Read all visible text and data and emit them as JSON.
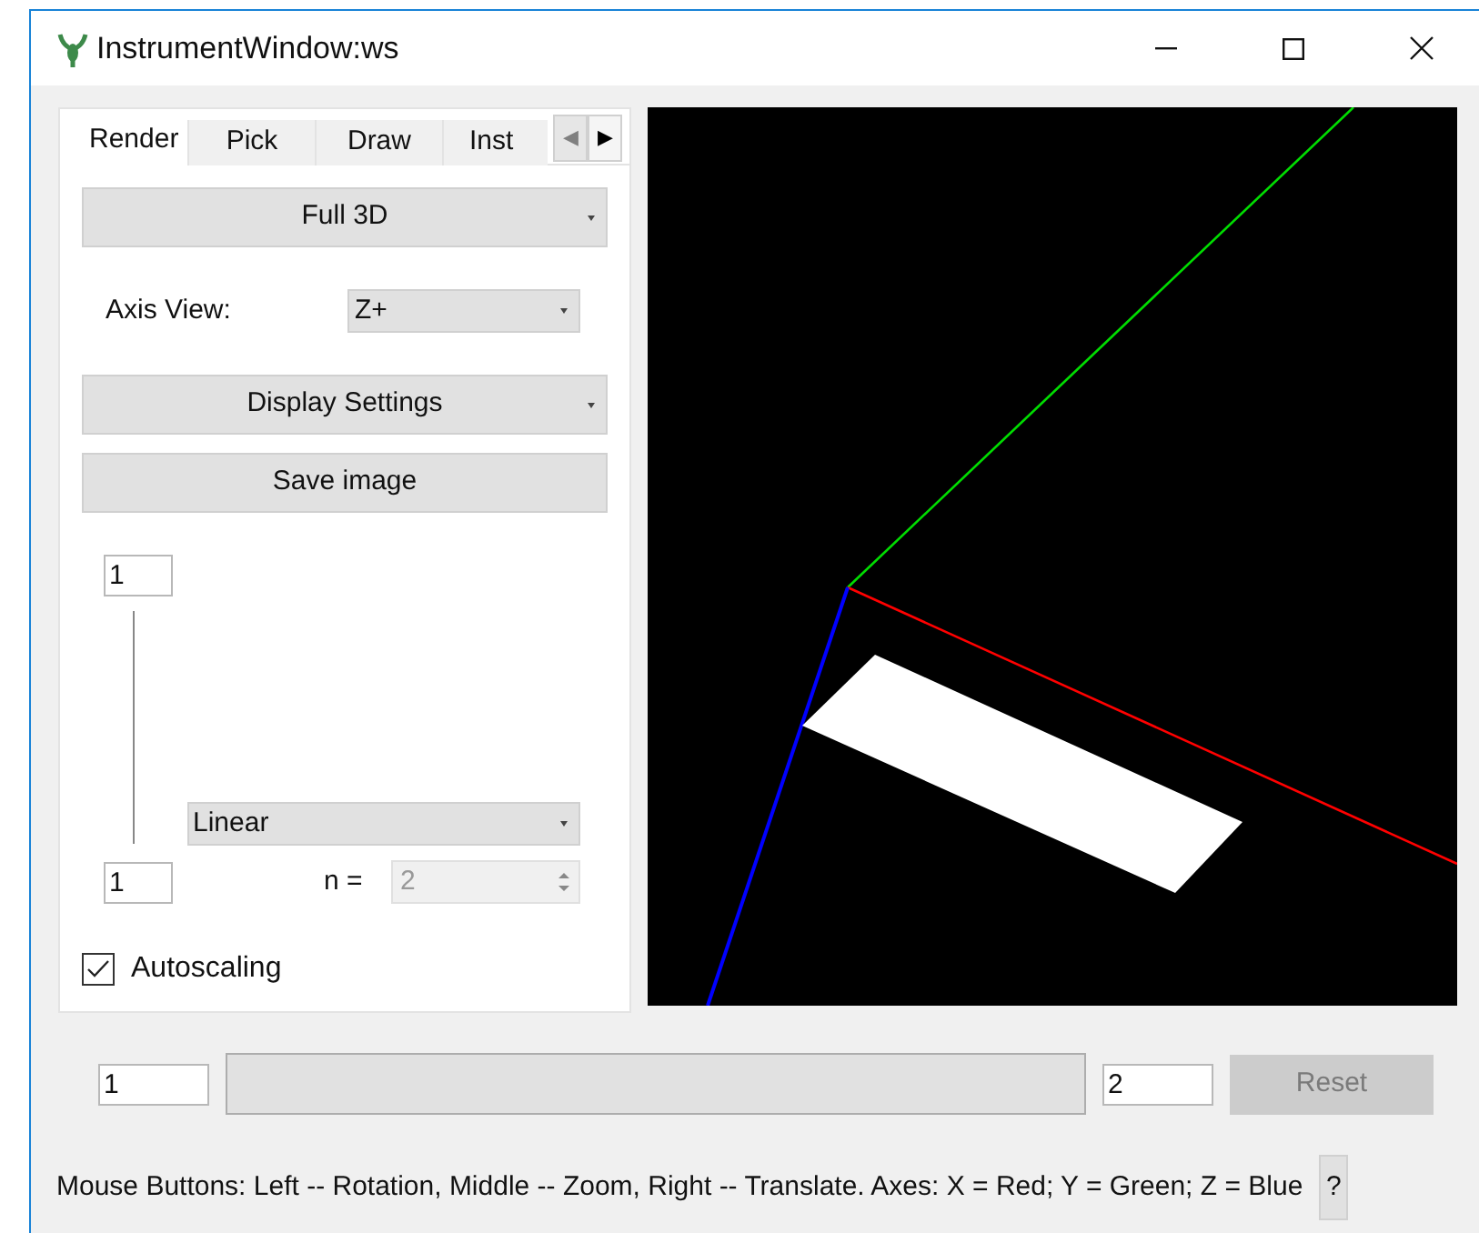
{
  "window": {
    "title": "InstrumentWindow:ws"
  },
  "tabs": [
    {
      "label": "Render",
      "selected": true
    },
    {
      "label": "Pick",
      "selected": false
    },
    {
      "label": "Draw",
      "selected": false
    },
    {
      "label": "Inst",
      "selected": false
    }
  ],
  "tab_scroll": [
    {
      "glyph": "◀",
      "disabled": true
    },
    {
      "glyph": "▶",
      "disabled": false
    }
  ],
  "projection": {
    "value": "Full 3D"
  },
  "axis_view": {
    "label": "Axis View:",
    "value": "Z+"
  },
  "display_settings": {
    "label": "Display Settings"
  },
  "save_image": {
    "label": "Save image"
  },
  "color_scale": {
    "max": "1",
    "min": "1",
    "scale_type": "Linear",
    "n_label": "n =",
    "n_value": "2",
    "n_disabled": true
  },
  "autoscaling": {
    "label": "Autoscaling",
    "checked": true
  },
  "range": {
    "min": "1",
    "max": "2",
    "reset": {
      "label": "Reset",
      "disabled": true
    }
  },
  "status_bar": {
    "text": "Mouse Buttons: Left -- Rotation, Middle -- Zoom, Right -- Translate. Axes: X = Red; Y = Green; Z = Blue",
    "help": "?"
  }
}
